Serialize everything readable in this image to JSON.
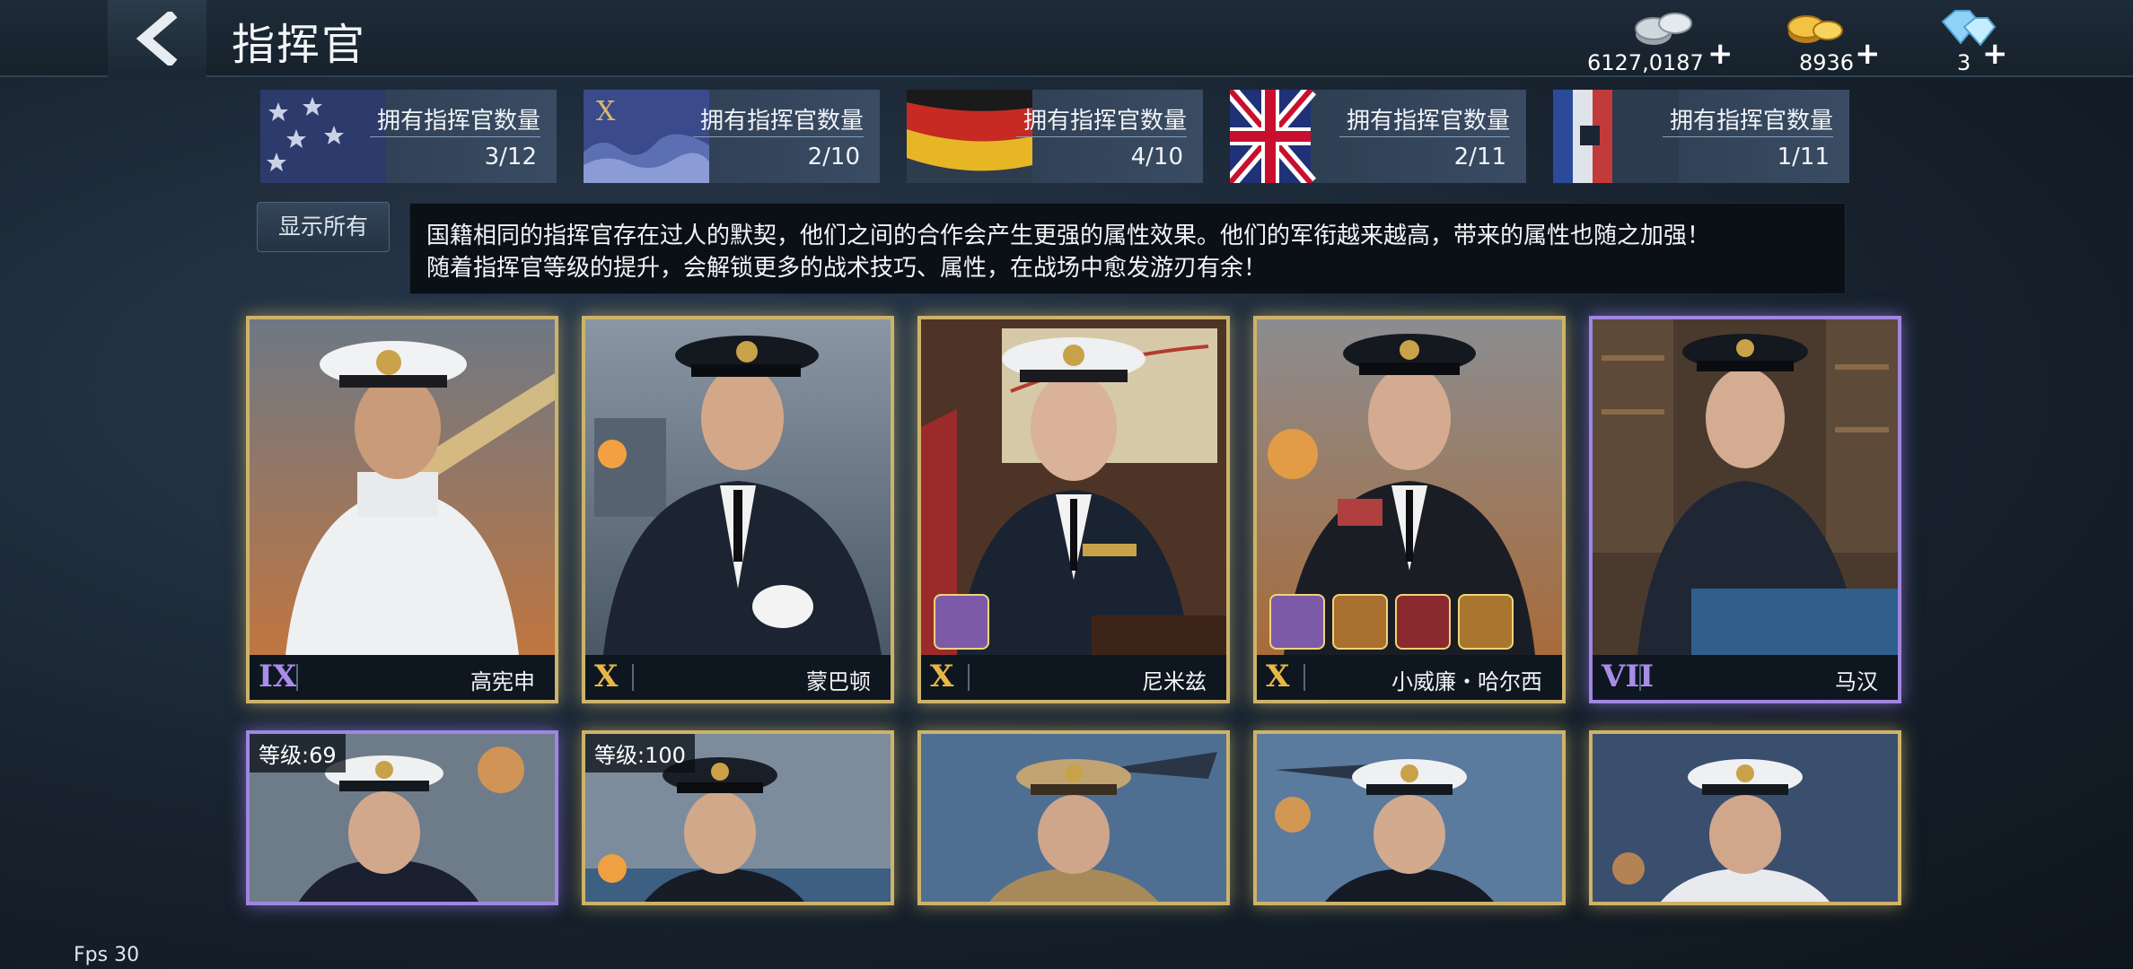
{
  "header": {
    "title": "指挥官",
    "back_icon": "chevron-left-icon"
  },
  "currencies": [
    {
      "name": "silver",
      "icon": "silver-coins-icon",
      "value": "6127,0187",
      "plus": "+"
    },
    {
      "name": "gold",
      "icon": "gold-coins-icon",
      "value": "8936",
      "plus": "+"
    },
    {
      "name": "diamond",
      "icon": "diamond-icon",
      "value": "3",
      "plus": "+"
    }
  ],
  "nations": [
    {
      "flag": "usa-flag-icon",
      "label": "拥有指挥官数量",
      "count": "3/12"
    },
    {
      "flag": "japan-flag-icon",
      "label": "拥有指挥官数量",
      "count": "2/10"
    },
    {
      "flag": "germany-flag-icon",
      "label": "拥有指挥官数量",
      "count": "4/10"
    },
    {
      "flag": "uk-flag-icon",
      "label": "拥有指挥官数量",
      "count": "2/11"
    },
    {
      "flag": "france-flag-icon",
      "label": "拥有指挥官数量",
      "count": "1/11"
    }
  ],
  "filters": {
    "show_all": "显示所有"
  },
  "description": {
    "line1": "国籍相同的指挥官存在过人的默契，他们之间的合作会产生更强的属性效果。他们的军衔越来越高，带来的属性也随之加强！",
    "line2": "随着指挥官等级的提升，会解锁更多的战术技巧、属性，在战场中愈发游刃有余！"
  },
  "commanders_row1": [
    {
      "rank": "IX",
      "name": "高宪申",
      "tier": "gold",
      "uniform": "white"
    },
    {
      "rank": "X",
      "name": "蒙巴顿",
      "tier": "gold",
      "uniform": "navy"
    },
    {
      "rank": "X",
      "name": "尼米兹",
      "tier": "gold",
      "uniform": "navy",
      "skills": [
        "ribbons-skill-icon"
      ]
    },
    {
      "rank": "X",
      "name": "小威廉・哈尔西",
      "tier": "gold",
      "uniform": "navy",
      "skills": [
        "ribbons-skill-icon",
        "pistol-skill-icon",
        "jacket-skill-icon",
        "cap-skill-icon"
      ]
    },
    {
      "rank": "VII",
      "name": "马汉",
      "tier": "purple",
      "uniform": "navy"
    }
  ],
  "commanders_row2": [
    {
      "level": "等级:69",
      "tier": "purple"
    },
    {
      "level": "等级:100",
      "tier": "gold"
    },
    {
      "level": "",
      "tier": "gold"
    },
    {
      "level": "",
      "tier": "gold"
    },
    {
      "level": "",
      "tier": "gold"
    }
  ],
  "footer": {
    "fps": "Fps 30"
  },
  "colors": {
    "gold_frame": "#cdb36a",
    "purple_frame": "#9f86e0",
    "rank_gold": "#e8b645",
    "rank_purple": "#a88ce8"
  }
}
